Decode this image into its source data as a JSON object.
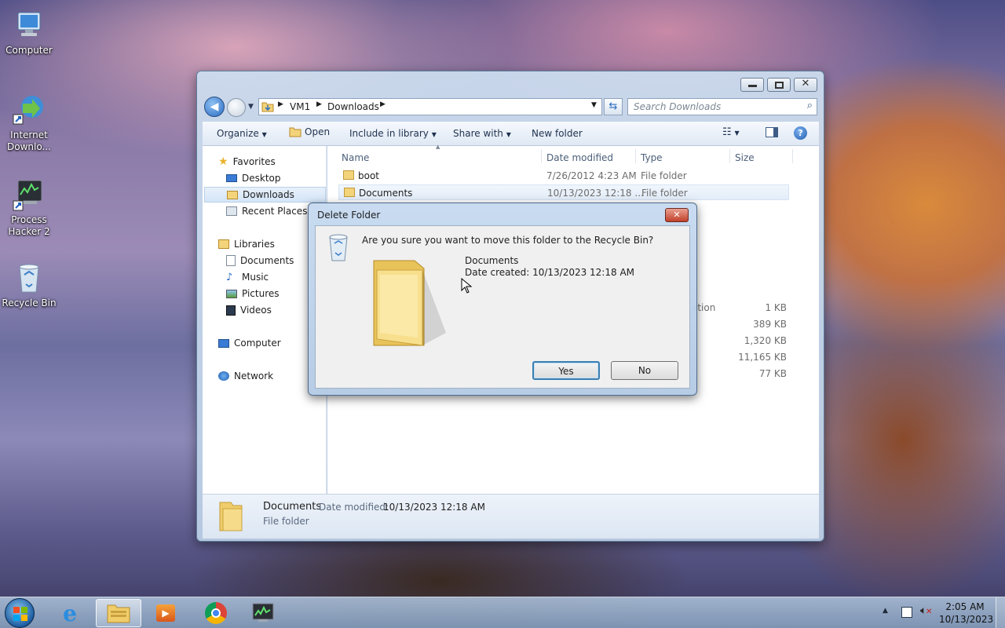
{
  "desktop": {
    "icons": [
      {
        "label_line1": "Computer",
        "label_line2": ""
      },
      {
        "label_line1": "Internet",
        "label_line2": "Downlo..."
      },
      {
        "label_line1": "Process",
        "label_line2": "Hacker 2"
      },
      {
        "label_line1": "Recycle Bin",
        "label_line2": ""
      }
    ]
  },
  "explorer": {
    "breadcrumb": [
      "VM1",
      "Downloads"
    ],
    "search_placeholder": "Search Downloads",
    "toolbar": {
      "organize": "Organize",
      "open": "Open",
      "include_in_library": "Include in library",
      "share_with": "Share with",
      "new_folder": "New folder"
    },
    "nav": {
      "favorites": "Favorites",
      "desktop": "Desktop",
      "downloads": "Downloads",
      "recent_places": "Recent Places",
      "libraries": "Libraries",
      "documents": "Documents",
      "music": "Music",
      "pictures": "Pictures",
      "videos": "Videos",
      "computer": "Computer",
      "network": "Network"
    },
    "columns": {
      "name": "Name",
      "date_modified": "Date modified",
      "type": "Type",
      "size": "Size"
    },
    "rows": [
      {
        "name": "boot",
        "date": "7/26/2012 4:23 AM",
        "type": "File folder",
        "size": ""
      },
      {
        "name": "Documents",
        "date": "10/13/2023 12:18 ...",
        "type": "File folder",
        "size": ""
      }
    ],
    "hidden_rows_partial": {
      "type_fragment": "ation",
      "sizes": [
        "1 KB",
        "389 KB",
        "1,320 KB",
        "11,165 KB",
        "77 KB"
      ]
    },
    "details": {
      "name": "Documents",
      "date_label": "Date modified:",
      "date_value": "10/13/2023 12:18 AM",
      "type": "File folder"
    }
  },
  "dialog": {
    "title": "Delete Folder",
    "question": "Are you sure you want to move this folder to the Recycle Bin?",
    "item_name": "Documents",
    "item_date": "Date created: 10/13/2023 12:18 AM",
    "yes": "Yes",
    "no": "No"
  },
  "taskbar": {
    "time": "2:05 AM",
    "date": "10/13/2023"
  }
}
